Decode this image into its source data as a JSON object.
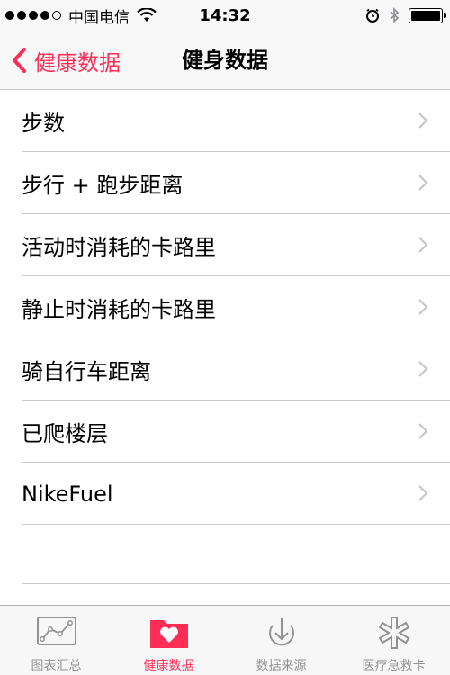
{
  "status_bar": {
    "carrier": "中国电信",
    "time": "14:32"
  },
  "nav": {
    "back_label": "健康数据",
    "title": "健身数据"
  },
  "list": {
    "items": [
      {
        "label": "步数"
      },
      {
        "label": "步行 + 跑步距离"
      },
      {
        "label": "活动时消耗的卡路里"
      },
      {
        "label": "静止时消耗的卡路里"
      },
      {
        "label": "骑自行车距离"
      },
      {
        "label": "已爬楼层"
      },
      {
        "label": "NikeFuel"
      }
    ]
  },
  "tabs": [
    {
      "label": "图表汇总",
      "icon": "chart-icon",
      "active": false
    },
    {
      "label": "健康数据",
      "icon": "health-folder-icon",
      "active": true
    },
    {
      "label": "数据来源",
      "icon": "download-icon",
      "active": false
    },
    {
      "label": "医疗急救卡",
      "icon": "medical-star-icon",
      "active": false
    }
  ],
  "colors": {
    "accent": "#ff2d55",
    "inactive": "#929292",
    "separator": "#c8c7cc"
  }
}
